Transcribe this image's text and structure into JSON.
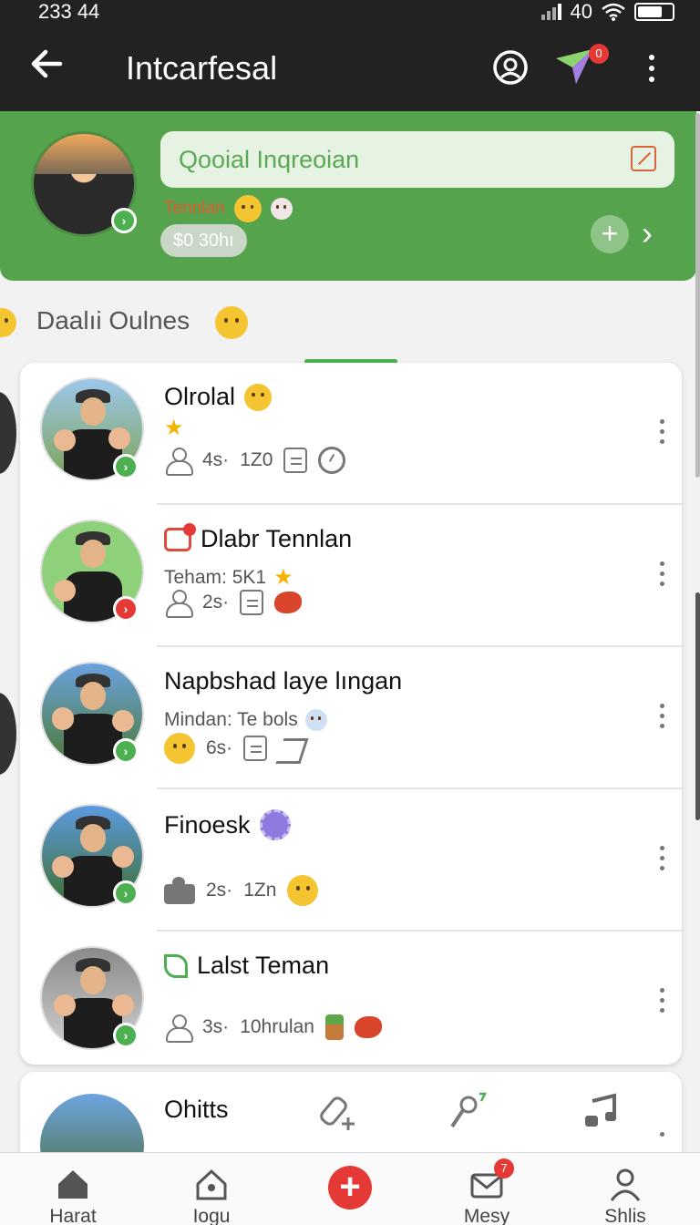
{
  "status_bar": {
    "time": "233 44",
    "battery_level": "40"
  },
  "app_bar": {
    "title": "Intcarfesal",
    "notification_count": "0"
  },
  "hero": {
    "search_placeholder": "Qooial Inqreoian",
    "subtitle": "Tennlan",
    "time_chip": "$0 30hı"
  },
  "section": {
    "title": "Daalıi Oulnes"
  },
  "contacts": [
    {
      "name": "Olrolal",
      "meta_count": "4s·",
      "meta_value": "1Z0"
    },
    {
      "name": "Dlabr Tennlan",
      "sub": "Teham: 5K1",
      "meta_count": "2s·"
    },
    {
      "name": "Napbshad laye lıngan",
      "sub": "Mindan: Te bols",
      "meta_count": "6s·"
    },
    {
      "name": "Finoesk",
      "meta_count": "2s·",
      "meta_value": "1Zn"
    },
    {
      "name": "Lalst Teman",
      "meta_count": "3s·",
      "meta_value": "10hrulan"
    }
  ],
  "partial_row": {
    "name": "Ohitts"
  },
  "bottom_nav": [
    {
      "label": "Harat",
      "icon": "home-icon"
    },
    {
      "label": "Iogu",
      "icon": "location-home-icon"
    },
    {
      "label": "",
      "icon": "add-icon"
    },
    {
      "label": "Mesy",
      "icon": "mail-icon",
      "badge": "7"
    },
    {
      "label": "Shlis",
      "icon": "profile-icon"
    }
  ],
  "colors": {
    "accent": "#56a34e",
    "appbar": "#222222",
    "alert": "#e53935"
  }
}
